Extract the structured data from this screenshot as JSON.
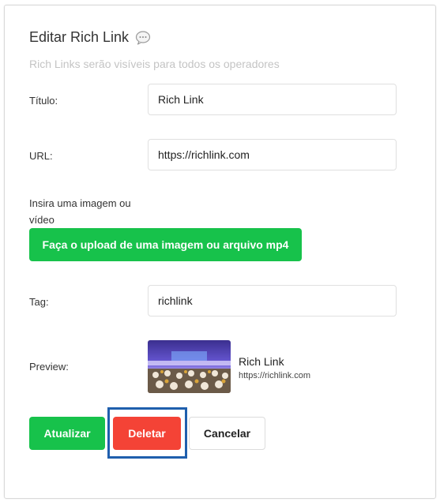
{
  "header": {
    "title": "Editar Rich Link",
    "title_icon": "speech-bubble-icon",
    "subtitle": "Rich Links serão visíveis para todos os operadores"
  },
  "form": {
    "title_label": "Título:",
    "title_value": "Rich Link",
    "url_label": "URL:",
    "url_value": "https://richlink.com",
    "media_label": "Insira uma imagem ou vídeo",
    "upload_button": "Faça o upload de uma imagem ou arquivo mp4",
    "tag_label": "Tag:",
    "tag_value": "richlink",
    "preview_label": "Preview:"
  },
  "preview": {
    "title": "Rich Link",
    "url": "https://richlink.com"
  },
  "actions": {
    "update": "Atualizar",
    "delete": "Deletar",
    "cancel": "Cancelar"
  },
  "colors": {
    "primary_green": "#17c24b",
    "danger_red": "#f44336",
    "highlight_blue": "#1f5fad"
  }
}
